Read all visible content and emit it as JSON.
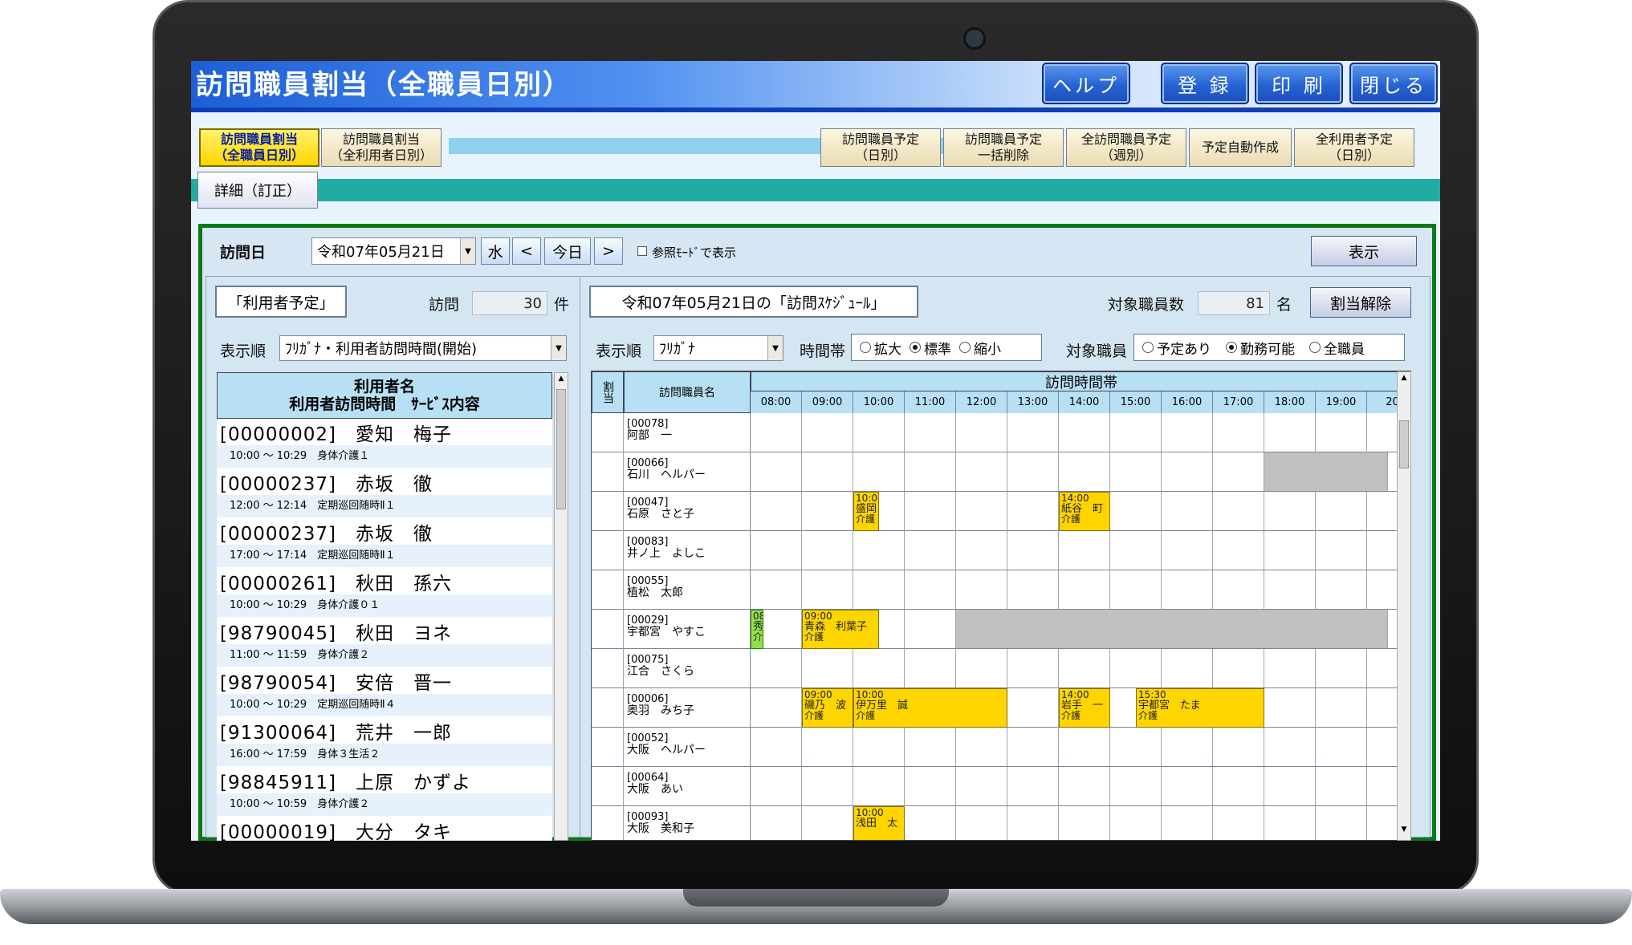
{
  "window": {
    "title": "訪問職員割当（全職員日別）"
  },
  "header_buttons": {
    "help": "ヘルプ",
    "register": "登 録",
    "print": "印 刷",
    "close": "閉じる"
  },
  "tabs": [
    {
      "label1": "訪問職員割当",
      "label2": "（全職員日別）"
    },
    {
      "label1": "訪問職員割当",
      "label2": "（全利用者日別）"
    },
    {
      "label1": "訪問職員予定",
      "label2": "（日別）"
    },
    {
      "label1": "訪問職員予定",
      "label2": "一括削除"
    },
    {
      "label1": "全訪問職員予定",
      "label2": "（週別）"
    },
    {
      "label1": "予定自動作成",
      "label2": ""
    },
    {
      "label1": "全利用者予定",
      "label2": "（日別）"
    }
  ],
  "detail_tab": "詳細（訂正）",
  "filter": {
    "visit_date_label": "訪問日",
    "visit_date": "令和07年05月21日",
    "weekday": "水",
    "prev": "<",
    "today": "今日",
    "next": ">",
    "ref_mode_label": "参照ﾓｰﾄﾞで表示",
    "show_button": "表示"
  },
  "left_panel": {
    "title": "「利用者予定」",
    "visit_label": "訪問",
    "visit_count": "30",
    "visit_unit": "件",
    "order_label": "表示順",
    "order_value": "ﾌﾘｶﾞﾅ・利用者訪問時間(開始)",
    "list_header1": "利用者名",
    "list_header2": "利用者訪問時間　ｻｰﾋﾞｽ内容",
    "rows": [
      {
        "name": "[00000002]　愛知　梅子",
        "time": "10:00 ～ 10:29　身体介護１"
      },
      {
        "name": "[00000237]　赤坂　徹",
        "time": "12:00 ～ 12:14　定期巡回随時Ⅱ１"
      },
      {
        "name": "[00000237]　赤坂　徹",
        "time": "17:00 ～ 17:14　定期巡回随時Ⅱ１"
      },
      {
        "name": "[00000261]　秋田　孫六",
        "time": "10:00 ～ 10:29　身体介護０１"
      },
      {
        "name": "[98790045]　秋田　ヨネ",
        "time": "11:00 ～ 11:59　身体介護２"
      },
      {
        "name": "[98790054]　安倍　晋一",
        "time": "10:00 ～ 10:29　定期巡回随時Ⅱ４"
      },
      {
        "name": "[91300064]　荒井　一郎",
        "time": "16:00 ～ 17:59　身体３生活２"
      },
      {
        "name": "[98845911]　上原　かずよ",
        "time": "10:00 ～ 10:59　身体介護２"
      },
      {
        "name": "[00000019]　大分　タキ",
        "time": ""
      }
    ]
  },
  "right_panel": {
    "title": "令和07年05月21日の「訪問ｽｹｼﾞｭｰﾙ」",
    "staff_count_label": "対象職員数",
    "staff_count": "81",
    "staff_unit": "名",
    "unassign_button": "割当解除",
    "order_label": "表示順",
    "order_value": "ﾌﾘｶﾞﾅ",
    "timezone_label": "時間帯",
    "timezone_options": [
      "拡大",
      "標準",
      "縮小"
    ],
    "timezone_selected": "標準",
    "target_label": "対象職員",
    "target_options": [
      "予定あり",
      "勤務可能",
      "全職員"
    ],
    "target_selected": "勤務可能",
    "grid_header_assign": "割当",
    "grid_header_staff": "訪問職員名",
    "grid_header_band": "訪問時間帯",
    "hours": [
      "08:00",
      "09:00",
      "10:00",
      "11:00",
      "12:00",
      "13:00",
      "14:00",
      "15:00",
      "16:00",
      "17:00",
      "18:00",
      "19:00",
      "20"
    ],
    "staff": [
      {
        "id": "[00078]",
        "name": "阿部　一"
      },
      {
        "id": "[00066]",
        "name": "石川　ヘルパー"
      },
      {
        "id": "[00047]",
        "name": "石原　さと子"
      },
      {
        "id": "[00083]",
        "name": "井ノ上　よしこ"
      },
      {
        "id": "[00055]",
        "name": "植松　太郎"
      },
      {
        "id": "[00029]",
        "name": "宇都宮　やすこ"
      },
      {
        "id": "[00075]",
        "name": "江合　さくら"
      },
      {
        "id": "[00006]",
        "name": "奥羽　みち子"
      },
      {
        "id": "[00052]",
        "name": "大阪　ヘルパー"
      },
      {
        "id": "[00064]",
        "name": "大阪　あい"
      },
      {
        "id": "[00093]",
        "name": "大阪　美和子"
      }
    ],
    "unavailable": [
      {
        "row": 1,
        "start": 18.0,
        "end": 20.4
      },
      {
        "row": 5,
        "start": 12.0,
        "end": 20.4
      }
    ],
    "appointments": [
      {
        "row": 2,
        "start": 10.0,
        "end": 10.5,
        "l1": "10:0",
        "l2": "盛岡",
        "l3": "介護",
        "color": "yellow"
      },
      {
        "row": 2,
        "start": 14.0,
        "end": 15.0,
        "l1": "14:00",
        "l2": "紙谷　町",
        "l3": "介護",
        "color": "yellow"
      },
      {
        "row": 5,
        "start": 8.0,
        "end": 8.25,
        "l1": "08",
        "l2": "秀",
        "l3": "介",
        "color": "green"
      },
      {
        "row": 5,
        "start": 9.0,
        "end": 10.5,
        "l1": "09:00",
        "l2": "青森　利葉子",
        "l3": "介護",
        "color": "yellow"
      },
      {
        "row": 7,
        "start": 9.0,
        "end": 10.0,
        "l1": "09:00",
        "l2": "磯乃　波",
        "l3": "介護",
        "color": "yellow"
      },
      {
        "row": 7,
        "start": 10.0,
        "end": 13.0,
        "l1": "10:00",
        "l2": "伊万里　誠",
        "l3": "介護",
        "color": "yellow"
      },
      {
        "row": 7,
        "start": 14.0,
        "end": 15.0,
        "l1": "14:00",
        "l2": "岩手　一",
        "l3": "介護",
        "color": "yellow"
      },
      {
        "row": 7,
        "start": 15.5,
        "end": 18.0,
        "l1": "15:30",
        "l2": "宇都宮　たま",
        "l3": "介護",
        "color": "yellow"
      },
      {
        "row": 10,
        "start": 10.0,
        "end": 11.0,
        "l1": "10:00",
        "l2": "浅田　太",
        "l3": "",
        "color": "yellow"
      }
    ]
  }
}
